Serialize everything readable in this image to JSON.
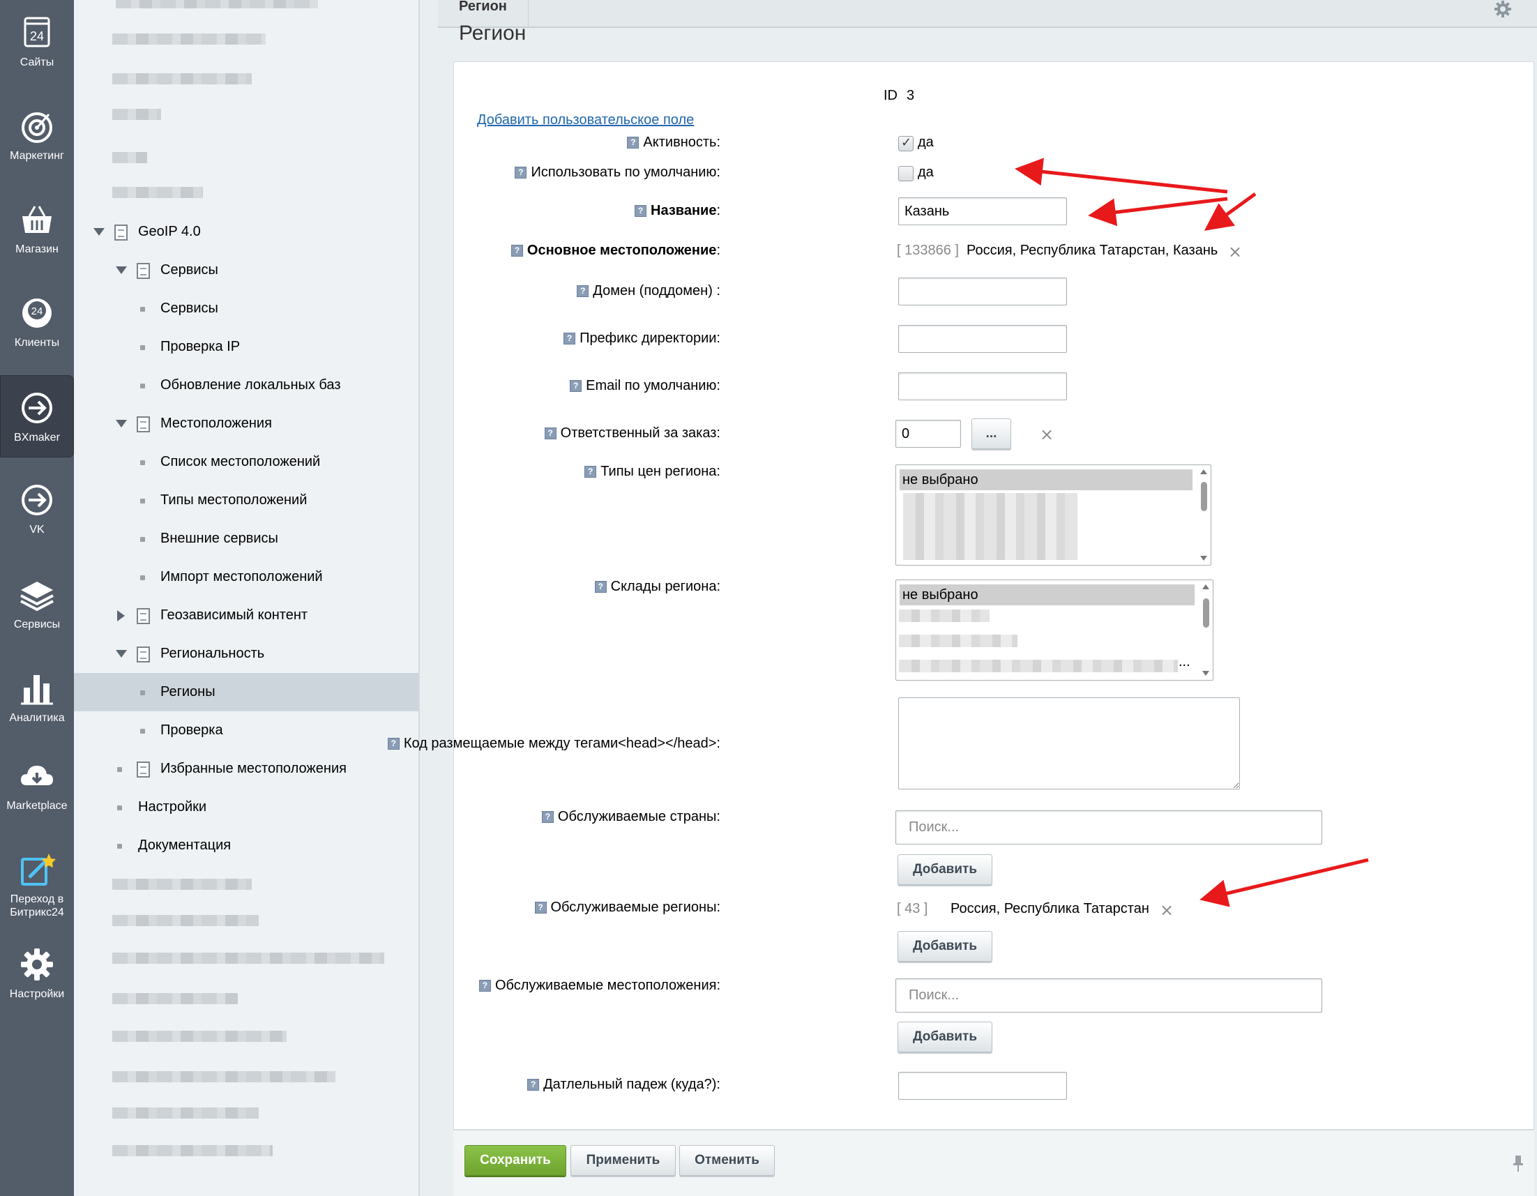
{
  "rail": {
    "items": [
      {
        "label": "Сайты",
        "icon": "sites-24-icon"
      },
      {
        "label": "Маркетинг",
        "icon": "target-icon"
      },
      {
        "label": "Магазин",
        "icon": "basket-icon"
      },
      {
        "label": "Клиенты",
        "icon": "clients-24-icon"
      },
      {
        "label": "BXmaker",
        "icon": "arrow-circle-icon"
      },
      {
        "label": "VK",
        "icon": "arrow-circle-icon"
      },
      {
        "label": "Сервисы",
        "icon": "layers-icon"
      },
      {
        "label": "Аналитика",
        "icon": "bar-chart-icon"
      },
      {
        "label": "Marketplace",
        "icon": "cloud-download-icon"
      },
      {
        "label": "Переход в Битрикс24",
        "icon": "edit-star-icon"
      },
      {
        "label": "Настройки",
        "icon": "gear-icon"
      }
    ]
  },
  "tree": {
    "items": [
      {
        "label": "GeoIP 4.0"
      },
      {
        "label": "Сервисы"
      },
      {
        "label": "Сервисы"
      },
      {
        "label": "Проверка IP"
      },
      {
        "label": "Обновление локальных баз"
      },
      {
        "label": "Местоположения"
      },
      {
        "label": "Список местоположений"
      },
      {
        "label": "Типы местоположений"
      },
      {
        "label": "Внешние сервисы"
      },
      {
        "label": "Импорт местоположений"
      },
      {
        "label": "Геозависимый контент"
      },
      {
        "label": "Региональность"
      },
      {
        "label": "Регионы"
      },
      {
        "label": "Проверка"
      },
      {
        "label": "Избранные местоположения"
      },
      {
        "label": "Настройки"
      },
      {
        "label": "Документация"
      }
    ]
  },
  "tabs": {
    "active": "Регион"
  },
  "page": {
    "title": "Регион"
  },
  "form": {
    "id_label": "ID",
    "id_value": "3",
    "add_field_link": "Добавить пользовательское поле",
    "help_glyph": "?",
    "active_label": "Активность:",
    "active_value": "да",
    "default_label": "Использовать по умолчанию:",
    "default_value": "да",
    "name_label": "Название",
    "name_colon": ":",
    "name_value": "Казань",
    "location_label": "Основное местоположение",
    "location_colon": ":",
    "location_code": "[ 133866 ]",
    "location_value": "Россия, Республика Татарстан, Казань",
    "domain_label": "Домен (поддомен) :",
    "prefix_label": "Префикс директории:",
    "email_label": "Email по умолчанию:",
    "responsible_label": "Ответственный за заказ:",
    "responsible_value": "0",
    "responsible_btn": "...",
    "price_types_label": "Типы цен региона:",
    "price_types_selected": "не выбрано",
    "stores_label": "Склады региона:",
    "stores_selected": "не выбрано",
    "stores_more": "...",
    "head_code_label": "Код размещаемые между тегами<head></head>:",
    "countries_label": "Обслуживаемые страны:",
    "countries_placeholder": "Поиск...",
    "add_label": "Добавить",
    "regions_label": "Обслуживаемые регионы:",
    "regions_code": "[ 43 ]",
    "regions_value": "Россия, Республика Татарстан",
    "locations_label": "Обслуживаемые местоположения:",
    "locations_placeholder": "Поиск...",
    "dative_label": "Датлельный падеж (куда?):"
  },
  "footer": {
    "save": "Сохранить",
    "apply": "Применить",
    "cancel": "Отменить"
  },
  "colors": {
    "rail_bg": "#535c69",
    "accent_green": "#7cb342",
    "annotation_red": "#e8191b",
    "link_blue": "#2067b0"
  }
}
